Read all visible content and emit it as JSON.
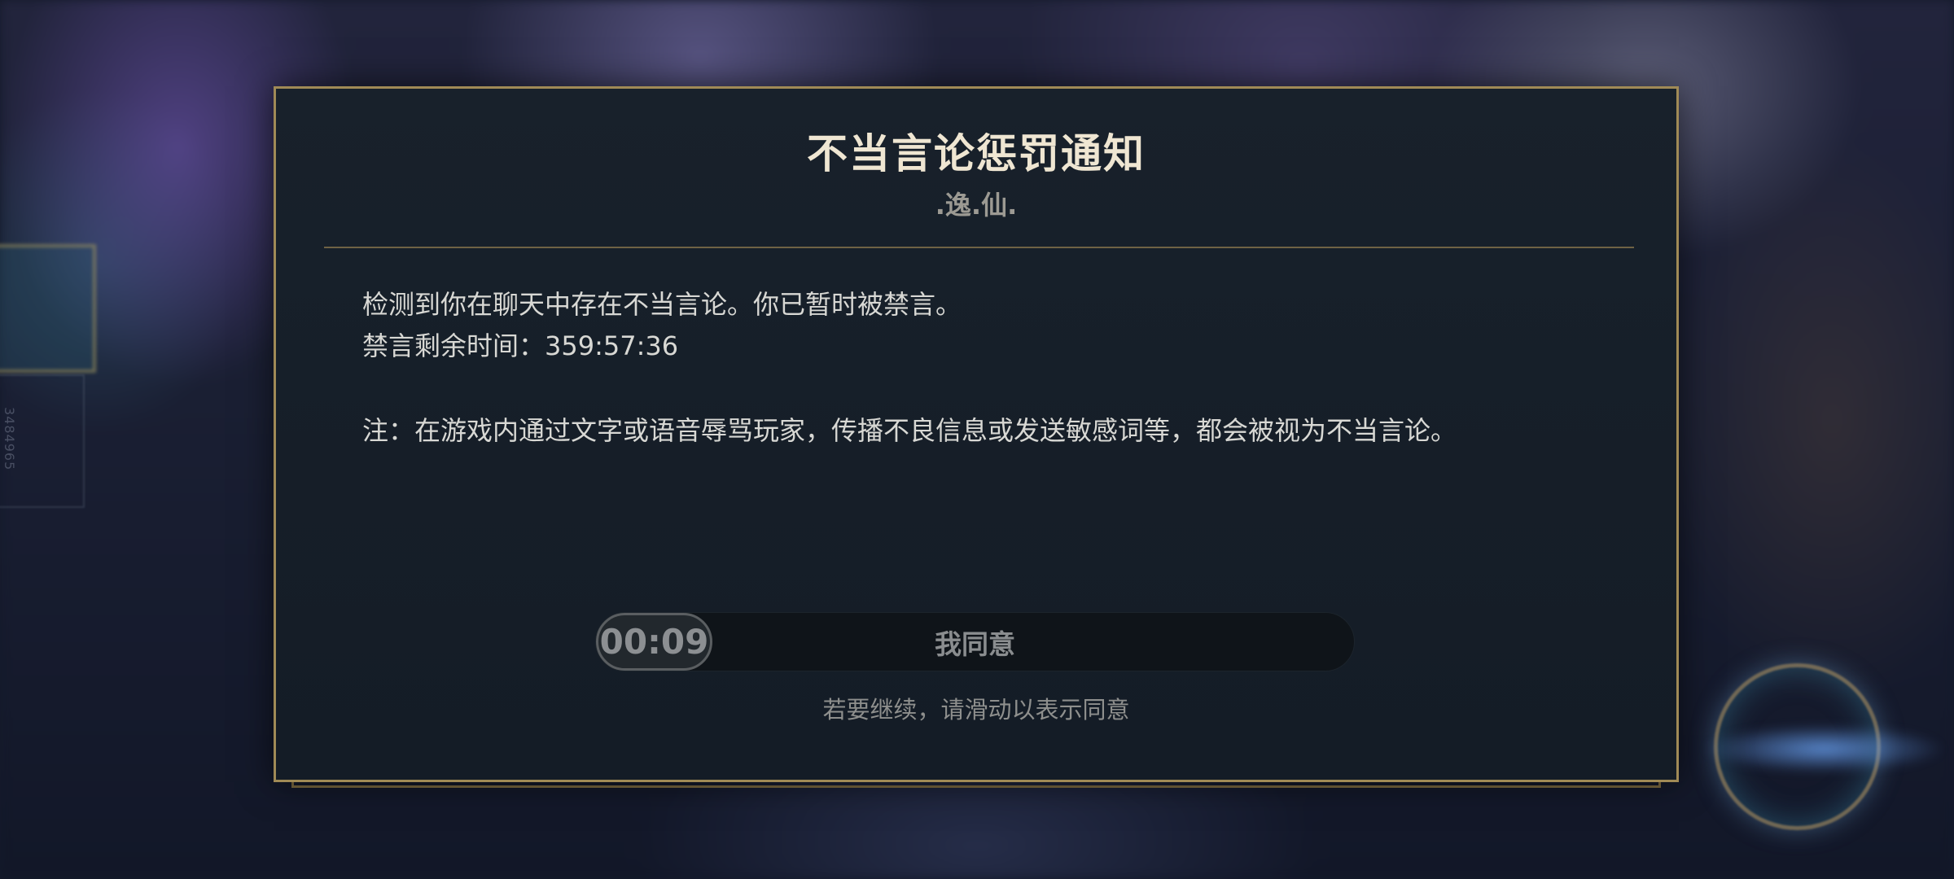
{
  "background": {
    "side_id_text": "3484965"
  },
  "dialog": {
    "title": "不当言论惩罚通知",
    "player_name": ".逸.仙.",
    "message_line1": "检测到你在聊天中存在不当言论。你已暂时被禁言。",
    "remaining_label": "禁言剩余时间：",
    "remaining_time": "359:57:36",
    "note": "注：在游戏内通过文字或语音辱骂玩家，传播不良信息或发送敏感词等，都会被视为不当言论。"
  },
  "slider": {
    "countdown": "00:09",
    "label": "我同意",
    "hint": "若要继续，请滑动以表示同意"
  },
  "colors": {
    "border_gold": "#a08a56",
    "title": "#efe6d2",
    "dialog_bg": "#18212b"
  }
}
